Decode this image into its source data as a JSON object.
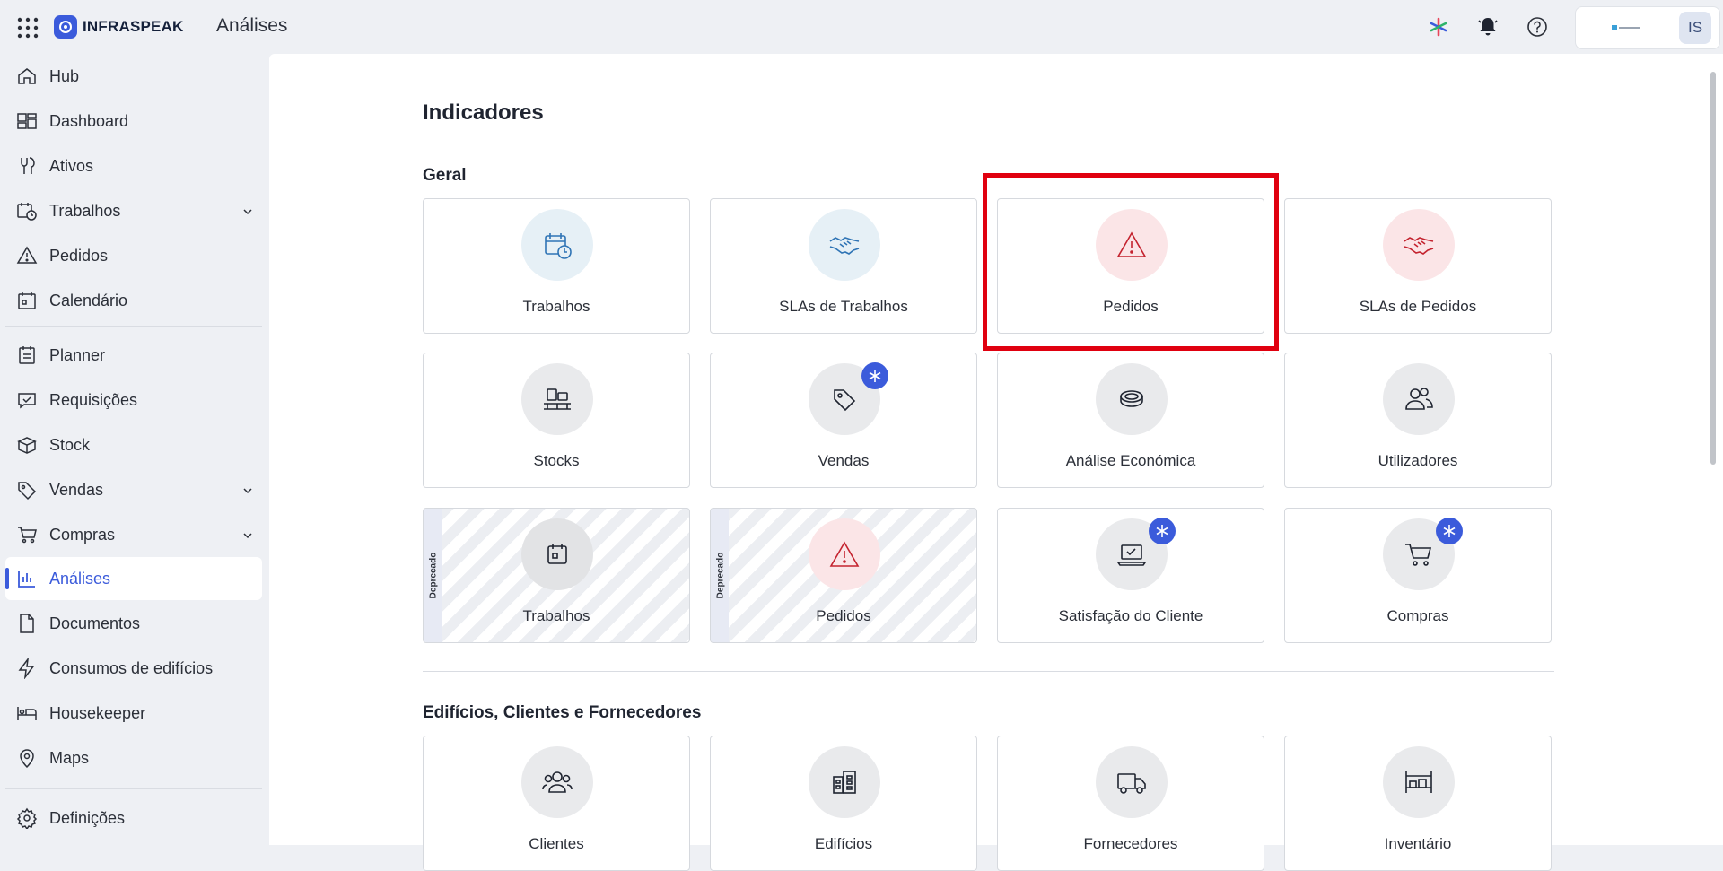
{
  "app": {
    "brand": "INFRASPEAK",
    "page_title": "Análises"
  },
  "account": {
    "avatar_initials": "IS"
  },
  "sidebar": {
    "items": [
      {
        "label": "Hub",
        "icon": "home-icon"
      },
      {
        "label": "Dashboard",
        "icon": "dashboard-icon"
      },
      {
        "label": "Ativos",
        "icon": "wrench-icon"
      },
      {
        "label": "Trabalhos",
        "icon": "calendar-clock-icon",
        "expandable": true
      },
      {
        "label": "Pedidos",
        "icon": "warning-icon"
      },
      {
        "label": "Calendário",
        "icon": "calendar-icon"
      },
      {
        "label": "Planner",
        "icon": "planner-icon"
      },
      {
        "label": "Requisições",
        "icon": "requisition-icon"
      },
      {
        "label": "Stock",
        "icon": "box-icon"
      },
      {
        "label": "Vendas",
        "icon": "tag-icon",
        "expandable": true
      },
      {
        "label": "Compras",
        "icon": "cart-icon",
        "expandable": true
      },
      {
        "label": "Análises",
        "icon": "bar-chart-icon",
        "active": true
      },
      {
        "label": "Documentos",
        "icon": "document-icon"
      },
      {
        "label": "Consumos de edifícios",
        "icon": "lightning-icon"
      },
      {
        "label": "Housekeeper",
        "icon": "bed-icon"
      },
      {
        "label": "Maps",
        "icon": "map-pin-icon"
      },
      {
        "label": "Definições",
        "icon": "gear-icon"
      }
    ]
  },
  "main": {
    "heading": "Indicadores",
    "sections": [
      {
        "title": "Geral",
        "cards": [
          {
            "label": "Trabalhos",
            "icon": "calendar-clock-icon",
            "tone": "blue"
          },
          {
            "label": "SLAs de Trabalhos",
            "icon": "handshake-icon",
            "tone": "blue"
          },
          {
            "label": "Pedidos",
            "icon": "warning-icon",
            "tone": "red",
            "highlighted": true
          },
          {
            "label": "SLAs de Pedidos",
            "icon": "handshake-icon",
            "tone": "red"
          },
          {
            "label": "Stocks",
            "icon": "pallet-icon",
            "tone": "grey"
          },
          {
            "label": "Vendas",
            "icon": "tag-icon",
            "tone": "grey",
            "new_badge": true
          },
          {
            "label": "Análise Económica",
            "icon": "coin-icon",
            "tone": "grey"
          },
          {
            "label": "Utilizadores",
            "icon": "users-icon",
            "tone": "grey"
          },
          {
            "label": "Trabalhos",
            "icon": "calendar-icon",
            "tone": "grey",
            "deprecated": true
          },
          {
            "label": "Pedidos",
            "icon": "warning-icon",
            "tone": "red",
            "deprecated": true
          },
          {
            "label": "Satisfação do Cliente",
            "icon": "laptop-check-icon",
            "tone": "grey",
            "new_badge": true
          },
          {
            "label": "Compras",
            "icon": "cart-icon",
            "tone": "grey",
            "new_badge": true
          }
        ]
      },
      {
        "title": "Edifícios, Clientes e Fornecedores",
        "cards": [
          {
            "label": "Clientes",
            "icon": "users-group-icon",
            "tone": "grey"
          },
          {
            "label": "Edifícios",
            "icon": "buildings-icon",
            "tone": "grey"
          },
          {
            "label": "Fornecedores",
            "icon": "truck-icon",
            "tone": "grey"
          },
          {
            "label": "Inventário",
            "icon": "shelf-icon",
            "tone": "grey"
          }
        ]
      }
    ],
    "deprecated_label": "Deprecado"
  }
}
